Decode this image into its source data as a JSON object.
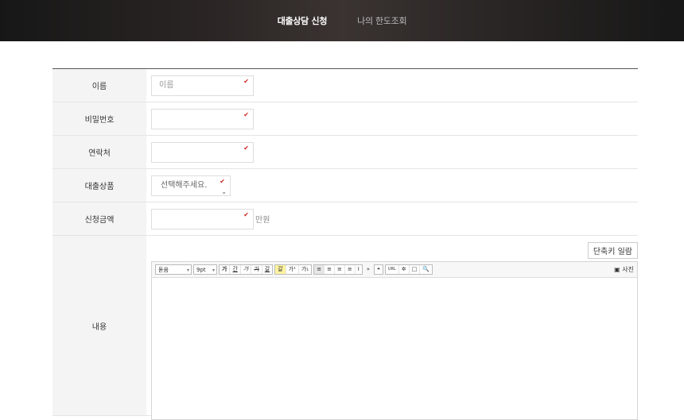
{
  "nav": {
    "items": [
      {
        "label": "대출상담 신청"
      },
      {
        "label": "나의 한도조회"
      }
    ]
  },
  "form": {
    "name_label": "이름",
    "name_placeholder": "이름",
    "password_label": "비밀번호",
    "contact_label": "연락처",
    "product_label": "대출상품",
    "product_selected": "선택해주세요.",
    "amount_label": "신청금액",
    "amount_unit": "만원",
    "content_label": "내용"
  },
  "editor": {
    "shortcut_label": "단축키 일람",
    "font_value": "돋움",
    "size_value": "9pt",
    "format_buttons": [
      "가",
      "간",
      "가",
      "가",
      "갈"
    ],
    "color_buttons": [
      "갈",
      "가¹",
      "가₁"
    ],
    "align_buttons": [
      "≡",
      "≡",
      "≡",
      "≡",
      "I"
    ],
    "insert_buttons": [
      "»",
      "❝",
      "URL",
      "✲",
      "□",
      "🔍"
    ],
    "photo_label": "사진"
  }
}
